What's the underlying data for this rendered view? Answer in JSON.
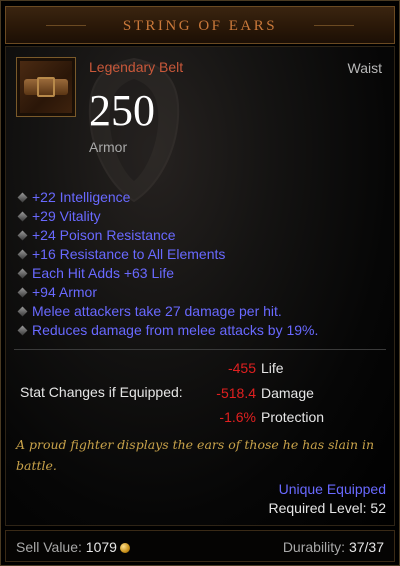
{
  "item": {
    "name": "STRING OF EARS",
    "type": "Legendary Belt",
    "slot": "Waist",
    "armor_value": "250",
    "armor_label": "Armor",
    "icon": "belt-icon"
  },
  "properties": [
    "+22 Intelligence",
    "+29 Vitality",
    "+24 Poison Resistance",
    "+16 Resistance to All Elements",
    "Each Hit Adds +63 Life",
    "+94 Armor",
    "Melee attackers take 27 damage per hit.",
    "Reduces damage from melee attacks by 19%."
  ],
  "stat_changes": {
    "label": "Stat Changes if Equipped:",
    "rows": [
      {
        "value": "-455",
        "name": "Life"
      },
      {
        "value": "-518.4",
        "name": "Damage"
      },
      {
        "value": "-1.6%",
        "name": "Protection"
      }
    ]
  },
  "flavor_text": "A proud fighter displays the ears of those he has slain in battle.",
  "unique_equipped": "Unique Equipped",
  "required_level": "Required Level: 52",
  "footer": {
    "sell_label": "Sell Value:",
    "sell_value": "1079",
    "durability_label": "Durability:",
    "durability_value": "37/37"
  },
  "colors": {
    "title": "#c9783a",
    "legendary": "#c9583a",
    "magic_property": "#6969ff",
    "negative": "#e02020",
    "flavor": "#c8a24a"
  }
}
